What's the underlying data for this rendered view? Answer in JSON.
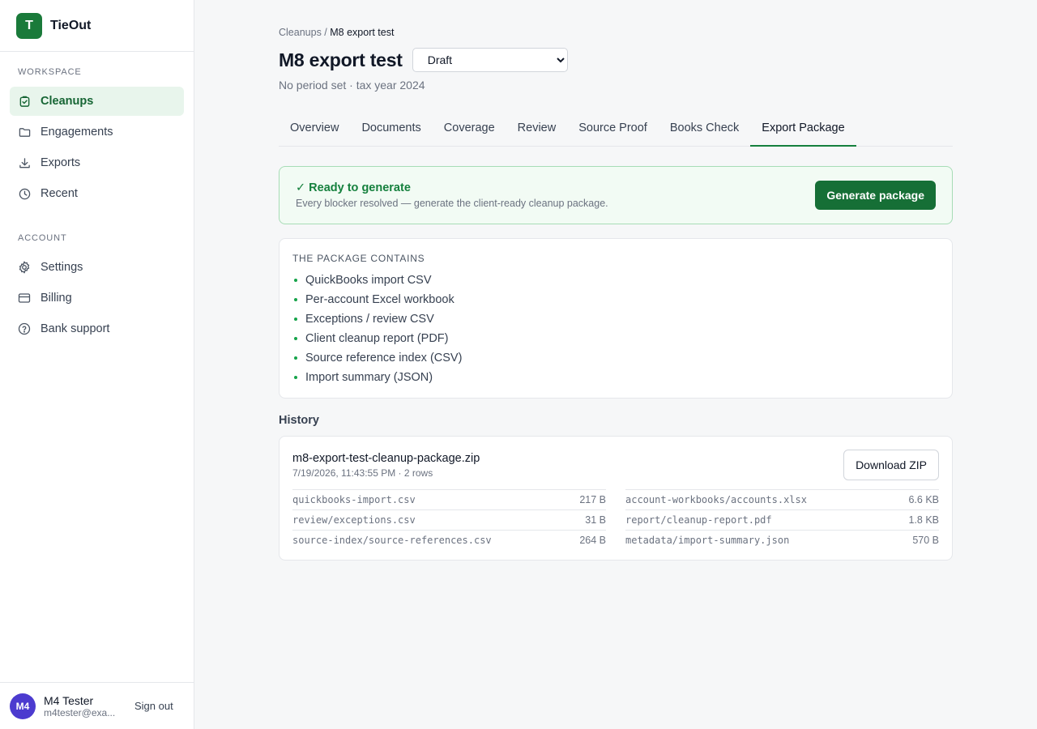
{
  "brand": {
    "logo_letter": "T",
    "name": "TieOut"
  },
  "sidebar": {
    "workspace_heading": "WORKSPACE",
    "workspace_items": [
      {
        "label": "Cleanups",
        "icon": "clipboard-check-icon",
        "active": true
      },
      {
        "label": "Engagements",
        "icon": "folder-icon"
      },
      {
        "label": "Exports",
        "icon": "download-icon"
      },
      {
        "label": "Recent",
        "icon": "clock-icon"
      }
    ],
    "account_heading": "ACCOUNT",
    "account_items": [
      {
        "label": "Settings",
        "icon": "gear-icon"
      },
      {
        "label": "Billing",
        "icon": "credit-card-icon"
      },
      {
        "label": "Bank support",
        "icon": "help-circle-icon"
      }
    ]
  },
  "user": {
    "initials": "M4",
    "name": "M4 Tester",
    "email": "m4tester@exa...",
    "signout_label": "Sign out"
  },
  "breadcrumb": {
    "parent": "Cleanups",
    "separator": " / ",
    "current": "M8 export test"
  },
  "page": {
    "title": "M8 export test",
    "status_value": "Draft",
    "subtitle": "No period set · tax year 2024"
  },
  "tabs": [
    "Overview",
    "Documents",
    "Coverage",
    "Review",
    "Source Proof",
    "Books Check",
    "Export Package"
  ],
  "active_tab": "Export Package",
  "ready": {
    "title": "✓ Ready to generate",
    "description": "Every blocker resolved — generate the client-ready cleanup package.",
    "button_label": "Generate package"
  },
  "package": {
    "heading": "THE PACKAGE CONTAINS",
    "items": [
      "QuickBooks import CSV",
      "Per-account Excel workbook",
      "Exceptions / review CSV",
      "Client cleanup report (PDF)",
      "Source reference index (CSV)",
      "Import summary (JSON)"
    ]
  },
  "history": {
    "heading": "History",
    "entry": {
      "file_name": "m8-export-test-cleanup-package.zip",
      "meta": "7/19/2026, 11:43:55 PM · 2 rows",
      "download_label": "Download ZIP",
      "files": [
        {
          "path": "quickbooks-import.csv",
          "size": "217 B"
        },
        {
          "path": "account-workbooks/accounts.xlsx",
          "size": "6.6 KB"
        },
        {
          "path": "review/exceptions.csv",
          "size": "31 B"
        },
        {
          "path": "report/cleanup-report.pdf",
          "size": "1.8 KB"
        },
        {
          "path": "source-index/source-references.csv",
          "size": "264 B"
        },
        {
          "path": "metadata/import-summary.json",
          "size": "570 B"
        }
      ]
    }
  },
  "colors": {
    "brand_green": "#1a7a3a",
    "accent_green": "#15803d",
    "avatar_purple": "#4c3bcf"
  }
}
